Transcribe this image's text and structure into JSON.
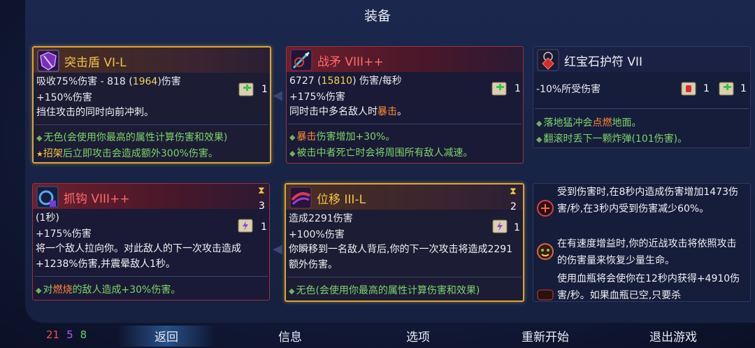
{
  "title": "装备",
  "cards": [
    {
      "name": "突击盾 VI-L",
      "stat1a": "吸收75%伤害 - 818 (",
      "stat1b": "1964",
      "stat1c": ")伤害",
      "stat2": "+150%伤害",
      "scroll_count": "1",
      "desc": "挡住攻击的同时向前冲刺。",
      "bullet1": "无色(会使用你最高的属性计算伤害和效果)",
      "bullet2a": "招架",
      "bullet2b": "后立即攻击会造成额外300%伤害。"
    },
    {
      "name": "战矛 VIII++",
      "stat1a": "6727 (",
      "stat1b": "15810",
      "stat1c": ") 伤害/每秒",
      "stat2": "+175%伤害",
      "scroll_count": "1",
      "desc_a": "同时击中多名敌人时",
      "desc_b": "暴击",
      "desc_c": "。",
      "bullet1a": "暴击",
      "bullet1b": "伤害增加+30%。",
      "bullet2": "被击中者死亡时会将周围所有敌人减速。"
    },
    {
      "name": "红宝石护符 VII",
      "stat1": "-10%所受伤害",
      "scroll_count1": "1",
      "scroll_count2": "1",
      "bullet1a": "落地猛冲会",
      "bullet1b": "点燃",
      "bullet1c": "地面。",
      "bullet2": "翻滚时丢下一颗炸弹(101伤害)。"
    },
    {
      "name": "抓钩 VIII++",
      "cooldown": "3",
      "stat1": "(1秒)",
      "stat2": "+175%伤害",
      "scroll_count": "1",
      "desc": "将一个敌人拉向你。对此敌人的下一次攻击造成+1238%伤害,并震晕敌人1秒。",
      "bullet1a": "对",
      "bullet1b": "燃烧",
      "bullet1c": "的敌人造成+30%伤害。"
    },
    {
      "name": "位移 III-L",
      "cooldown": "2",
      "stat1": "造成2291伤害",
      "stat2": "+100%伤害",
      "scroll_count": "1",
      "desc": "你瞬移到一名敌人背后,你的下一次攻击将造成2291额外伤害。",
      "bullet1": "无色(会使用你最高的属性计算伤害和效果)"
    }
  ],
  "passives": [
    {
      "text": "受到伤害时,在8秒内造成伤害增加1473伤害/秒,在3秒内受到伤害减少60%。"
    },
    {
      "text": "在有速度增益时,你的近战攻击将依照攻击的伤害量来恢复少量生命。"
    },
    {
      "text": "使用血瓶将会使你在12秒内获得+4910伤害/秒。如果血瓶已空,只要杀"
    }
  ],
  "stats": {
    "red": "21",
    "purple": "5",
    "green": "8"
  },
  "nav": {
    "back": "返回",
    "info": "信息",
    "options": "选项",
    "restart": "重新开始",
    "quit": "退出游戏"
  }
}
